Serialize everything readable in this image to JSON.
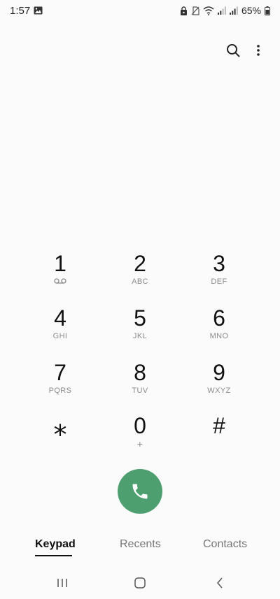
{
  "status_bar": {
    "time": "1:57",
    "battery": "65%",
    "icons": [
      "gallery-icon",
      "lock-icon",
      "no-sim-icon",
      "wifi-icon",
      "signal-icon",
      "signal-icon",
      "battery-icon"
    ]
  },
  "header": {
    "actions": [
      "search-icon",
      "more-vert-icon"
    ]
  },
  "keypad": {
    "keys": [
      {
        "digit": "1",
        "letters": ""
      },
      {
        "digit": "2",
        "letters": "ABC"
      },
      {
        "digit": "3",
        "letters": "DEF"
      },
      {
        "digit": "4",
        "letters": "GHI"
      },
      {
        "digit": "5",
        "letters": "JKL"
      },
      {
        "digit": "6",
        "letters": "MNO"
      },
      {
        "digit": "7",
        "letters": "PQRS"
      },
      {
        "digit": "8",
        "letters": "TUV"
      },
      {
        "digit": "9",
        "letters": "WXYZ"
      },
      {
        "digit": "⁎",
        "letters": ""
      },
      {
        "digit": "0",
        "letters": "+"
      },
      {
        "digit": "#",
        "letters": ""
      }
    ]
  },
  "call": {
    "color": "#4e9f6f"
  },
  "tabs": [
    {
      "label": "Keypad",
      "active": true
    },
    {
      "label": "Recents",
      "active": false
    },
    {
      "label": "Contacts",
      "active": false
    }
  ],
  "nav": [
    "recents-icon",
    "home-icon",
    "back-icon"
  ]
}
